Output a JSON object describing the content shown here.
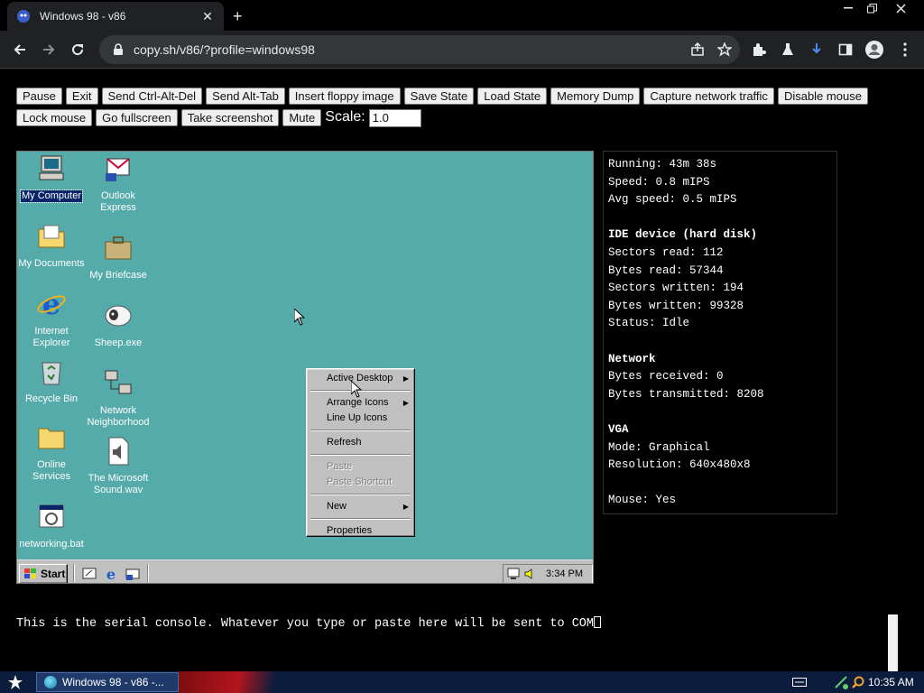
{
  "browser": {
    "tab_title": "Windows 98 - v86",
    "url": "copy.sh/v86/?profile=windows98",
    "new_tab_symbol": "+"
  },
  "controls": {
    "buttons": [
      "Pause",
      "Exit",
      "Send Ctrl-Alt-Del",
      "Send Alt-Tab",
      "Insert floppy image",
      "Save State",
      "Load State",
      "Memory Dump",
      "Capture network traffic",
      "Disable mouse",
      "Lock mouse",
      "Go fullscreen",
      "Take screenshot",
      "Mute"
    ],
    "scale_label": "Scale:",
    "scale_value": "1.0"
  },
  "desktop": {
    "icons": [
      {
        "name": "my-computer",
        "label": "My Computer"
      },
      {
        "name": "outlook-express",
        "label": "Outlook Express"
      },
      {
        "name": "my-documents",
        "label": "My Documents"
      },
      {
        "name": "my-briefcase",
        "label": "My Briefcase"
      },
      {
        "name": "internet-explorer",
        "label": "Internet Explorer"
      },
      {
        "name": "sheep-exe",
        "label": "Sheep.exe"
      },
      {
        "name": "recycle-bin",
        "label": "Recycle Bin"
      },
      {
        "name": "network-neighborhood",
        "label": "Network Neighborhood"
      },
      {
        "name": "online-services",
        "label": "Online Services"
      },
      {
        "name": "microsoft-sound",
        "label": "The Microsoft Sound.wav"
      },
      {
        "name": "networking-bat",
        "label": "networking.bat"
      }
    ],
    "context_menu": {
      "active_desktop": "Active Desktop",
      "arrange_icons": "Arrange Icons",
      "line_up_icons": "Line Up Icons",
      "refresh": "Refresh",
      "paste": "Paste",
      "paste_shortcut": "Paste Shortcut",
      "new": "New",
      "properties": "Properties"
    },
    "taskbar": {
      "start_label": "Start",
      "clock": "3:34 PM"
    }
  },
  "stats": {
    "running": "Running: 43m 38s",
    "speed": "Speed: 0.8 mIPS",
    "avg_speed": "Avg speed: 0.5 mIPS",
    "ide_heading": "IDE device (hard disk)",
    "sectors_read": "Sectors read: 112",
    "bytes_read": "Bytes read: 57344",
    "sectors_written": "Sectors written: 194",
    "bytes_written": "Bytes written: 99328",
    "status": "Status: Idle",
    "network_heading": "Network",
    "bytes_received": "Bytes received: 0",
    "bytes_transmitted": "Bytes transmitted: 8208",
    "vga_heading": "VGA",
    "mode": "Mode: Graphical",
    "resolution": "Resolution: 640x480x8",
    "mouse": "Mouse: Yes"
  },
  "console": {
    "text": "This is the serial console. Whatever you type or paste here will be sent to COM"
  },
  "host": {
    "task_label": "Windows 98 - v86 -...",
    "clock": "10:35 AM"
  }
}
